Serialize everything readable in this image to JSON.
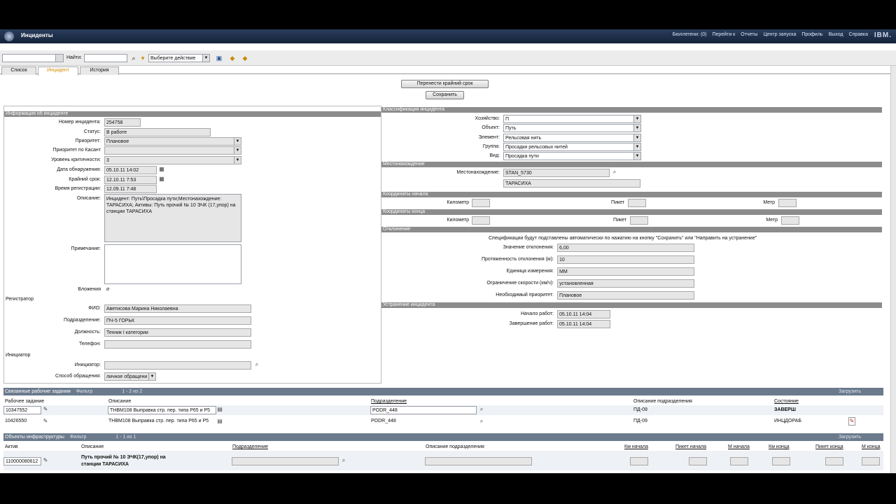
{
  "app": {
    "title": "Инциденты",
    "ibm": "IBM."
  },
  "nav": {
    "bulletins": "Бюллетени: (0)",
    "goto": "Перейти к",
    "reports": "Отчеты",
    "start_center": "Центр запуска",
    "profile": "Профиль",
    "logout": "Выход",
    "help": "Справка"
  },
  "toolbar": {
    "find_label": "Найти:",
    "find_value": "",
    "action_placeholder": "Выберите действие"
  },
  "tabs": [
    "Список",
    "Инцидент",
    "История"
  ],
  "buttons": {
    "move_deadline": "Перенести крайний срок",
    "save": "Сохранить"
  },
  "incident": {
    "header": "Информация об инциденте",
    "number_label": "Номер инцидента:",
    "number": "254758",
    "status_label": "Статус:",
    "status": "В работе",
    "priority_label": "Приоритет:",
    "priority": "Плановое",
    "priority_kasant_label": "Приоритет по Касант",
    "priority_kasant": "",
    "criticality_label": "Уровень критичности:",
    "criticality": "3",
    "detect_label": "Дата обнаружения:",
    "detect": "05.10.11 14:02",
    "deadline_label": "Крайний срок:",
    "deadline": "12.10.11 7:53",
    "reg_time_label": "Время регистрации:",
    "reg_time": "12.09.11 7:48",
    "desc_label": "Описание:",
    "desc": "Инцидент: Путь\\Просадка пути;Местонахождение: ТАРАСИХА; Активы: Путь прочий № 10 ЭЧК (17,упор) на станции ТАРАСИХА",
    "note_label": "Примечание:",
    "note": "",
    "attach_label": "Вложения",
    "registrar_header": "Регистратор",
    "fio_label": "ФИО:",
    "fio": "Аветисова Марина Николаевна",
    "dept_label": "Подразделение:",
    "dept": "ПЧ-5 ГОРЬК",
    "position_label": "Должность:",
    "position": "Техник I категории",
    "phone_label": "Телефон:",
    "phone": "",
    "initiator_header": "Инициатор",
    "initiator_label": "Инициатор:",
    "initiator": "",
    "method_label": "Способ обращения:",
    "method": "личное обращени"
  },
  "classif": {
    "header": "Классификация инцидента",
    "farm_label": "Хозяйство:",
    "farm": "П",
    "object_label": "Объект:",
    "object": "Путь",
    "element_label": "Элемент:",
    "element": "Рельсовая нить",
    "group_label": "Группа:",
    "group": "Просадки рельсовых нитей",
    "type_label": "Вид:",
    "type": "Просадка пути"
  },
  "location": {
    "header": "Местонахождение",
    "label": "Местонахождение:",
    "code": "STAN_5730",
    "name": "ТАРАСИХА"
  },
  "coords_start": {
    "header": "Координаты начала",
    "km": "Километр",
    "picket": "Пикет",
    "meter": "Метр"
  },
  "coords_end": {
    "header": "Координаты конца",
    "km": "Километр",
    "picket": "Пикет",
    "meter": "Метр"
  },
  "deviation": {
    "header": "Отклонение",
    "note": "Спецификации будут подставлены автоматически по нажатию на кнопку \"Сохранить\" или \"Направить на устранение\"",
    "value_label": "Значение отклонения:",
    "value": "6,00",
    "length_label": "Протяженность отклонения (м):",
    "length": "10",
    "unit_label": "Единица измерения:",
    "unit": "ММ",
    "speed_label": "Ограничение скорости (км/ч):",
    "speed": "установленная",
    "priority_label": "Необходимый приоритет:",
    "priority": "Плановое"
  },
  "elimination": {
    "header": "Устранение инцидента",
    "start_label": "Начало работ:",
    "start": "05.10.11 14:04",
    "end_label": "Завершение работ:",
    "end": "05.10.11 14:04"
  },
  "work_orders": {
    "header": "Связанные рабочие задания",
    "filter": "Фильтр",
    "pager": "1 - 2 из 2",
    "download": "Загрузить",
    "columns": [
      "Рабочее задание",
      "Описание",
      "Подразделение",
      "Описание подразделения",
      "Состояние"
    ],
    "rows": [
      {
        "id": "10347552",
        "desc": "ТНВМ108 Выправка стр. пер. типа Р65 и Р5",
        "dept": "PODR_448",
        "dept_desc": "ПД-09",
        "state": "ЗАВЕРШ"
      },
      {
        "id": "10426550",
        "desc": "ТНВМ108 Выправка стр. пер. типа Р65 и Р5",
        "dept": "PODR_448",
        "dept_desc": "ПД-09",
        "state": "ИНЦДОРАБ"
      }
    ]
  },
  "assets": {
    "header": "Объекты инфраструктуры",
    "filter": "Фильтр",
    "pager": "1 - 1 из 1",
    "download": "Загрузить",
    "columns": [
      "Актив",
      "Описание",
      "Подразделение",
      "Описание подразделения",
      "Км начала",
      "Пикет начала",
      "М начала",
      "Км конца",
      "Пикет конца",
      "М конца"
    ],
    "row": {
      "id": "110000080612",
      "desc": "Путь прочий № 10 ЭЧК(17,упор) на станции ТАРАСИХА"
    }
  }
}
